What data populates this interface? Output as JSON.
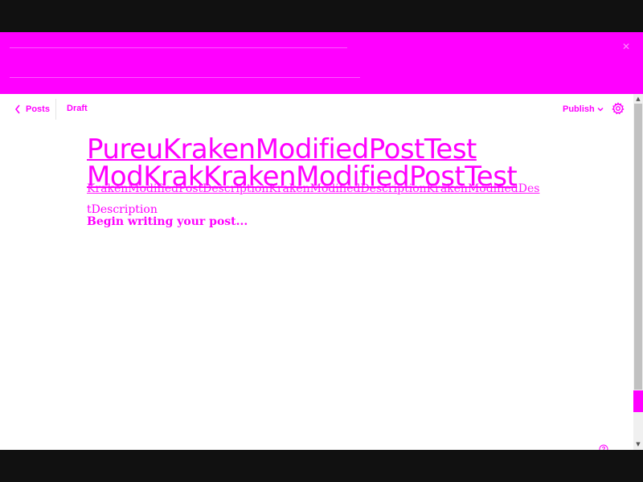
{
  "editor": {
    "back_label": "Posts",
    "status": "Draft",
    "publish_label": "Publish"
  },
  "post": {
    "title": "PureuKrakenModifiedPostTest\nModKrakKrakenModifiedPostTest",
    "excerpt": "KrakenModifiedPostDescriptionKrakenModifiedDescriptionKrakenModifiedDes",
    "description_label": "tDescription",
    "body_placeholder": "Begin writing your post..."
  },
  "colors": {
    "accent": "#ff00ff",
    "background": "#ffffff",
    "frame": "#111111"
  },
  "icons": {
    "back": "chevron-left-icon",
    "publish": "chevron-down-icon",
    "settings": "gear-icon",
    "help": "help-icon",
    "banner_close": "close-icon"
  }
}
